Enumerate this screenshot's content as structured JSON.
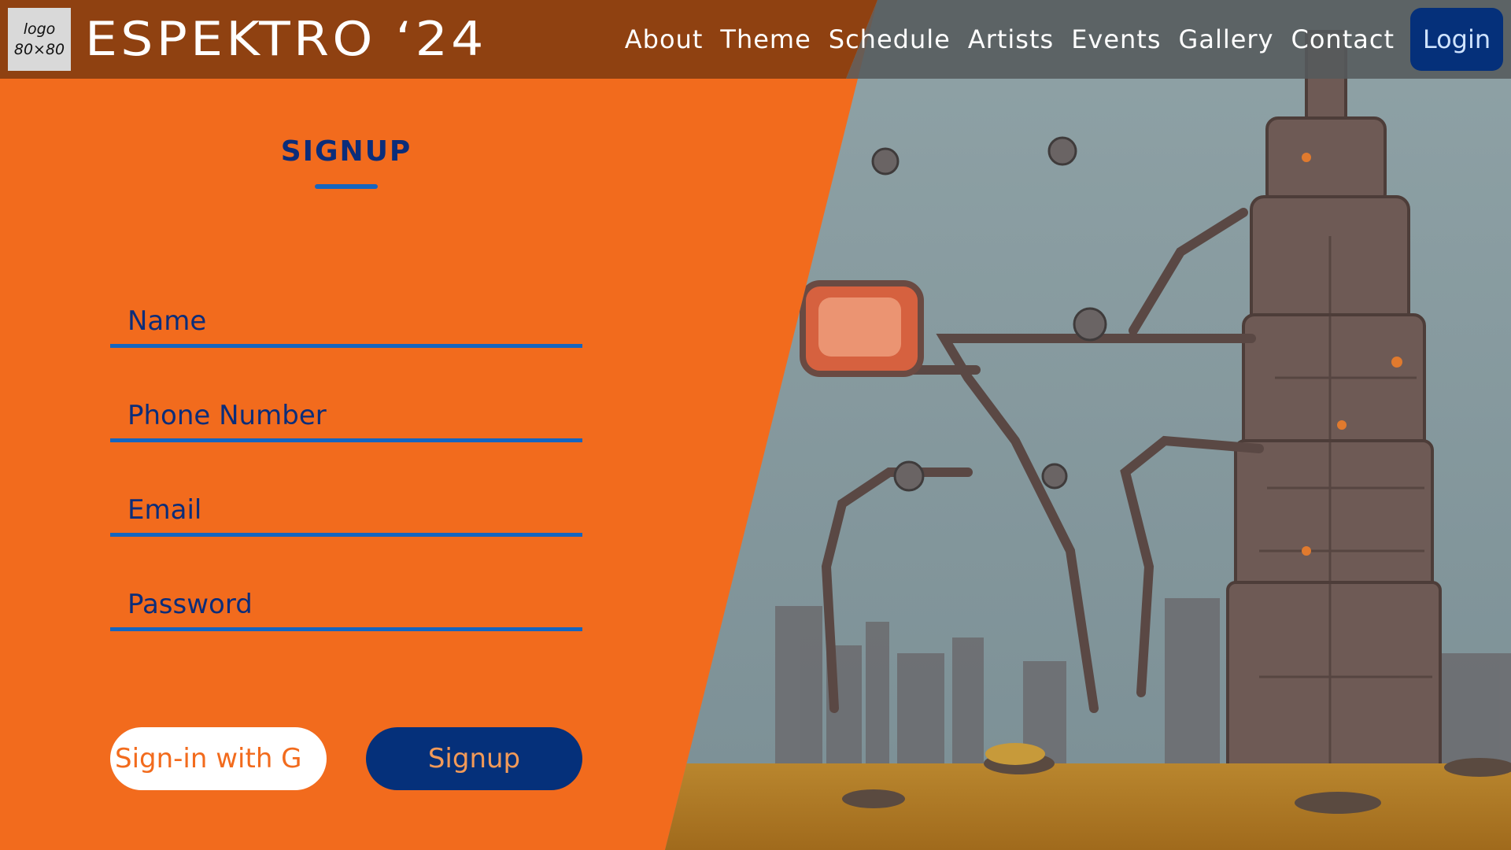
{
  "header": {
    "logo_placeholder": "logo\n80×80",
    "brand": "ESPEKTRO ‘24",
    "nav": [
      "About",
      "Theme",
      "Schedule",
      "Artists",
      "Events",
      "Gallery",
      "Contact"
    ],
    "login_label": "Login"
  },
  "form": {
    "title": "SIGNUP",
    "name_placeholder": "Name",
    "phone_placeholder": "Phone Number",
    "email_placeholder": "Email",
    "password_placeholder": "Password",
    "google_label": "Sign-in with G",
    "signup_label": "Signup"
  },
  "colors": {
    "primary_orange": "#f26b1d",
    "navy": "#05307a",
    "accent_blue": "#1565c0"
  }
}
